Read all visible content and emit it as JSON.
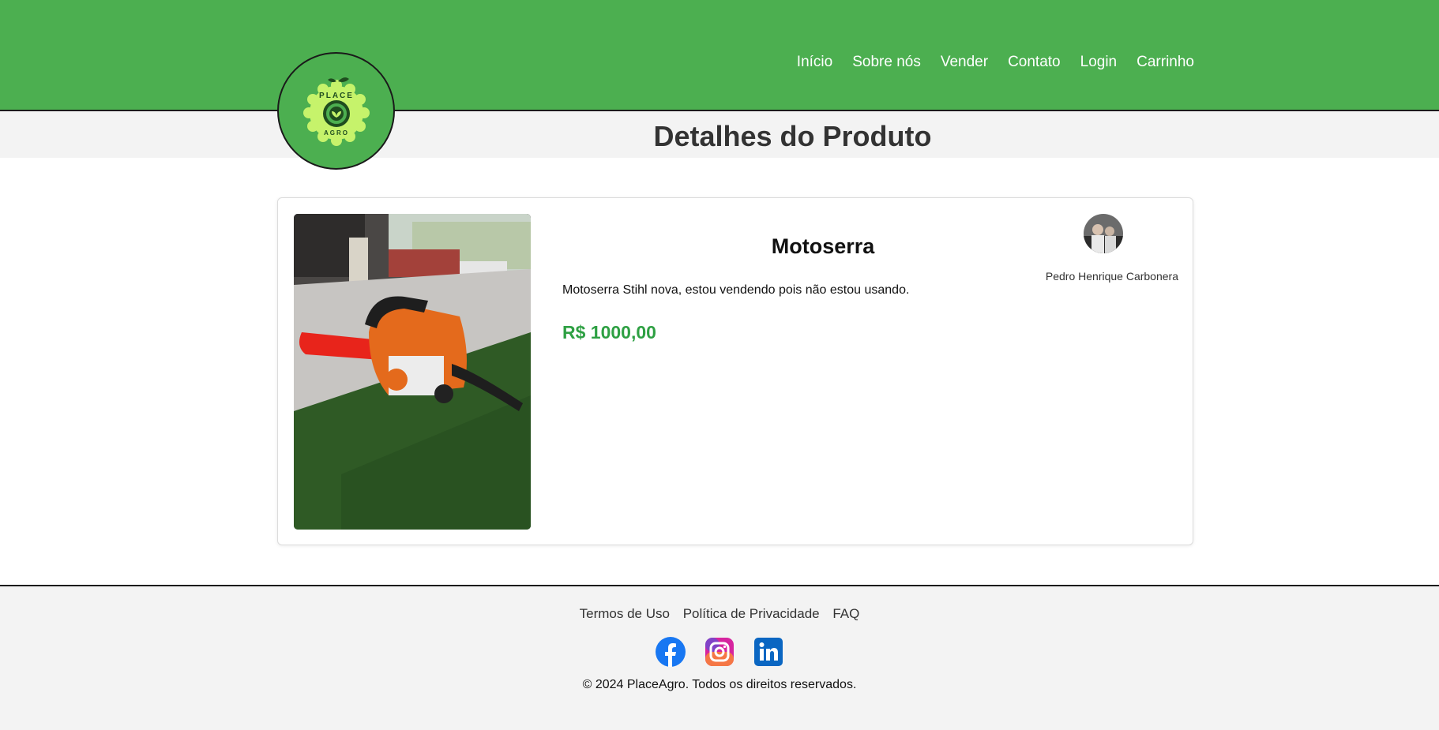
{
  "brand": {
    "logo_top": "PLACE",
    "logo_bottom": "AGRO"
  },
  "nav": {
    "items": [
      "Início",
      "Sobre nós",
      "Vender",
      "Contato",
      "Login",
      "Carrinho"
    ]
  },
  "page": {
    "title": "Detalhes do Produto"
  },
  "product": {
    "name": "Motoserra",
    "description": "Motoserra Stihl nova, estou vendendo pois não estou usando.",
    "price": "R$ 1000,00"
  },
  "seller": {
    "name": "Pedro Henrique Carbonera"
  },
  "footer": {
    "links": [
      "Termos de Uso",
      "Política de Privacidade",
      "FAQ"
    ],
    "socials": [
      "facebook-icon",
      "instagram-icon",
      "linkedin-icon"
    ],
    "copyright": "© 2024 PlaceAgro. Todos os direitos reservados."
  },
  "colors": {
    "header_green": "#4caf50",
    "price_green": "#2ea043",
    "footer_bg": "#f3f3f3"
  }
}
